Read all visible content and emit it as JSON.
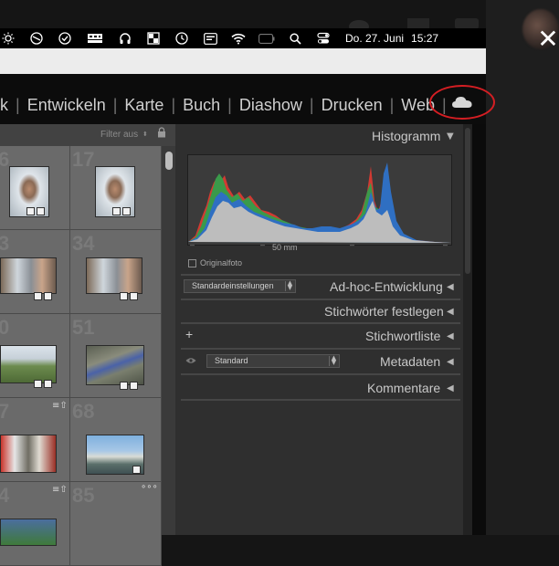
{
  "menubar": {
    "icons": [
      "brightness-icon",
      "do-not-disturb-icon",
      "checkmark-circle-icon",
      "battery-menu-icon",
      "headphones-icon",
      "window-grid-icon",
      "time-machine-icon",
      "keyboard-icon",
      "wifi-icon",
      "battery-icon",
      "search-icon",
      "control-center-icon"
    ],
    "date": "Do. 27. Juni",
    "time": "15:27"
  },
  "modules": {
    "partial_first": "k",
    "items": [
      "Entwickeln",
      "Karte",
      "Buch",
      "Diashow",
      "Drucken",
      "Web"
    ],
    "cloud_icon": "cloud-icon"
  },
  "annotation": {
    "ring_color": "#d51e23"
  },
  "grid": {
    "filter_label": "Filter aus",
    "rows": [
      {
        "numbers": [
          "6",
          "17"
        ]
      },
      {
        "numbers": [
          "3",
          "34"
        ]
      },
      {
        "numbers": [
          "0",
          "51"
        ]
      },
      {
        "numbers": [
          "7",
          "68"
        ]
      },
      {
        "numbers": [
          "4",
          "85"
        ]
      }
    ]
  },
  "right_panel": {
    "histogram": {
      "title": "Histogramm",
      "focal_length": "50 mm",
      "original_label": "Originalfoto"
    },
    "quick_develop": {
      "preset": "Standardeinstellungen",
      "title": "Ad-hoc-Entwicklung"
    },
    "keywording": {
      "title": "Stichwörter festlegen"
    },
    "keyword_list": {
      "plus": "+",
      "title": "Stichwortliste"
    },
    "metadata": {
      "preset": "Standard",
      "title": "Metadaten"
    },
    "comments": {
      "title": "Kommentare"
    }
  },
  "close_symbol": "✕"
}
